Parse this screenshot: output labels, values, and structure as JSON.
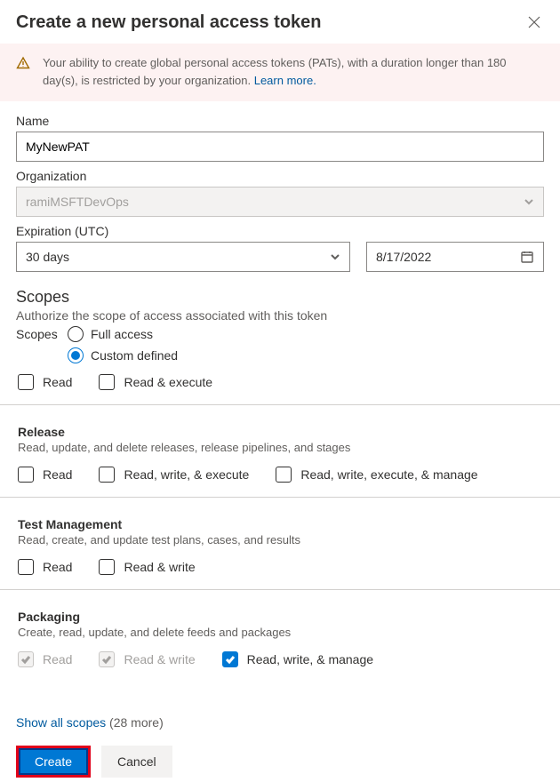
{
  "header": {
    "title": "Create a new personal access token"
  },
  "warning": {
    "text": "Your ability to create global personal access tokens (PATs), with a duration longer than 180 day(s), is restricted by your organization. ",
    "link": "Learn more."
  },
  "fields": {
    "name_label": "Name",
    "name_value": "MyNewPAT",
    "org_label": "Organization",
    "org_value": "ramiMSFTDevOps",
    "exp_label": "Expiration (UTC)",
    "exp_dropdown": "30 days",
    "exp_date": "8/17/2022"
  },
  "scopes": {
    "heading": "Scopes",
    "subheading": "Authorize the scope of access associated with this token",
    "label": "Scopes",
    "full_access": "Full access",
    "custom_defined": "Custom defined"
  },
  "partial": {
    "opts": [
      "Read",
      "Read & execute"
    ]
  },
  "groups": [
    {
      "title": "Release",
      "desc": "Read, update, and delete releases, release pipelines, and stages",
      "opts": [
        {
          "label": "Read",
          "checked": false,
          "disabled": false
        },
        {
          "label": "Read, write, & execute",
          "checked": false,
          "disabled": false
        },
        {
          "label": "Read, write, execute, & manage",
          "checked": false,
          "disabled": false
        }
      ]
    },
    {
      "title": "Test Management",
      "desc": "Read, create, and update test plans, cases, and results",
      "opts": [
        {
          "label": "Read",
          "checked": false,
          "disabled": false
        },
        {
          "label": "Read & write",
          "checked": false,
          "disabled": false
        }
      ]
    },
    {
      "title": "Packaging",
      "desc": "Create, read, update, and delete feeds and packages",
      "opts": [
        {
          "label": "Read",
          "checked": true,
          "disabled": true
        },
        {
          "label": "Read & write",
          "checked": true,
          "disabled": true
        },
        {
          "label": "Read, write, & manage",
          "checked": true,
          "disabled": false
        }
      ]
    }
  ],
  "show_scopes": {
    "link": "Show all scopes",
    "count": " (28 more)"
  },
  "footer": {
    "create": "Create",
    "cancel": "Cancel"
  }
}
